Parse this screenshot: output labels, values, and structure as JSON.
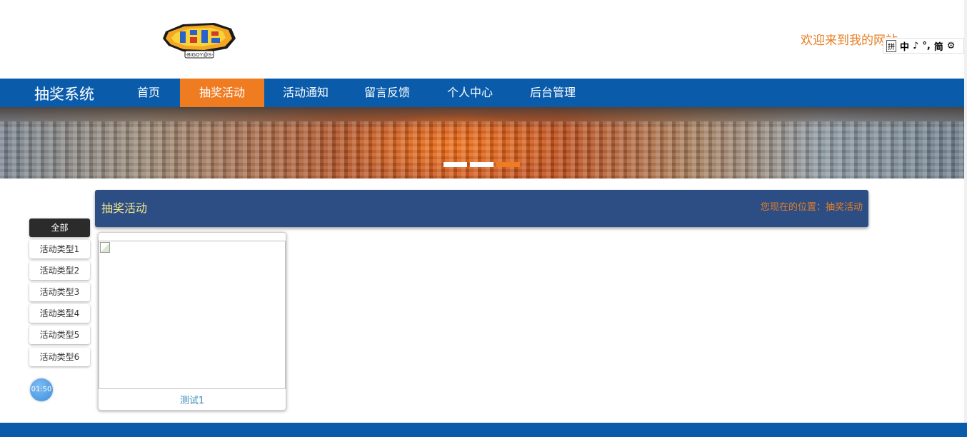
{
  "header": {
    "welcome": "欢迎来到我的网站",
    "logo_text": "-BIGOY@S-",
    "ime_toolbar": [
      "拼",
      "中",
      "♪",
      "°,",
      "简",
      "⚙"
    ]
  },
  "nav": {
    "brand": "抽奖系统",
    "items": [
      {
        "label": "首页",
        "active": false
      },
      {
        "label": "抽奖活动",
        "active": true
      },
      {
        "label": "活动通知",
        "active": false
      },
      {
        "label": "留言反馈",
        "active": false
      },
      {
        "label": "个人中心",
        "active": false
      },
      {
        "label": "后台管理",
        "active": false
      }
    ]
  },
  "banner": {
    "slide_count": 3,
    "active_slide": 3
  },
  "sidebar": {
    "items": [
      {
        "label": "全部",
        "active": true
      },
      {
        "label": "活动类型1",
        "active": false
      },
      {
        "label": "活动类型2",
        "active": false
      },
      {
        "label": "活动类型3",
        "active": false
      },
      {
        "label": "活动类型4",
        "active": false
      },
      {
        "label": "活动类型5",
        "active": false
      },
      {
        "label": "活动类型6",
        "active": false
      }
    ],
    "clock": "01:50"
  },
  "section": {
    "title": "抽奖活动",
    "breadcrumb": "您现在的位置：抽奖活动"
  },
  "cards": [
    {
      "title": "测试1"
    }
  ],
  "colors": {
    "nav_bg": "#0a5cab",
    "accent": "#f07c22",
    "section_bg": "#2d4e85",
    "section_title": "#f4e98a",
    "breadcrumb": "#e67e22",
    "card_title": "#3a87b9"
  }
}
